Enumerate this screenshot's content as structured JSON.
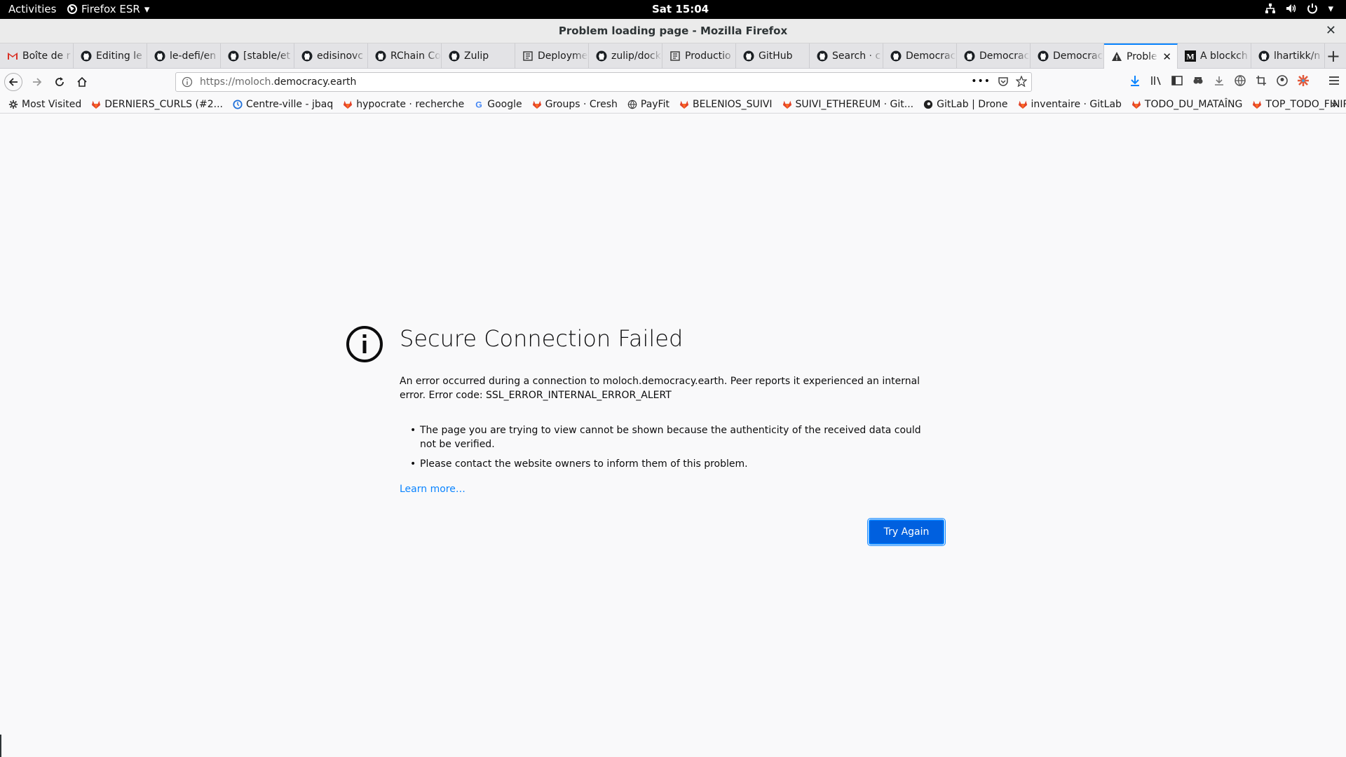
{
  "topbar": {
    "activities": "Activities",
    "app_menu": "Firefox ESR",
    "clock": "Sat 15:04"
  },
  "window": {
    "title": "Problem loading page - Mozilla Firefox"
  },
  "tabs": [
    {
      "label": "Boîte de r",
      "icon": "gmail-icon"
    },
    {
      "label": "Editing le",
      "icon": "github-icon"
    },
    {
      "label": "le-defi/en",
      "icon": "github-icon"
    },
    {
      "label": "[stable/et",
      "icon": "github-icon"
    },
    {
      "label": "edisinovc",
      "icon": "github-icon"
    },
    {
      "label": "RChain Co",
      "icon": "github-icon"
    },
    {
      "label": "Zulip",
      "icon": "github-icon"
    },
    {
      "label": "Deployme",
      "icon": "doc-icon"
    },
    {
      "label": "zulip/dock",
      "icon": "github-icon"
    },
    {
      "label": "Productio",
      "icon": "doc-icon"
    },
    {
      "label": "GitHub",
      "icon": "github-icon"
    },
    {
      "label": "Search · c",
      "icon": "github-icon"
    },
    {
      "label": "Democrac",
      "icon": "github-icon"
    },
    {
      "label": "Democrac",
      "icon": "github-icon"
    },
    {
      "label": "Democrac",
      "icon": "github-icon"
    },
    {
      "label": "Proble",
      "icon": "warning-icon",
      "active": true
    },
    {
      "label": "A blockch",
      "icon": "medium-icon"
    },
    {
      "label": "lhartikk/n",
      "icon": "github-icon"
    }
  ],
  "urlbar": {
    "protocol": "https://moloch.",
    "host": "democracy.earth"
  },
  "bookmarks": [
    {
      "label": "Most Visited",
      "icon": "gear-icon"
    },
    {
      "label": "DERNIERS_CURLS (#2...",
      "icon": "gitlab-icon"
    },
    {
      "label": "Centre-ville - jbaq",
      "icon": "clock-icon"
    },
    {
      "label": "hypocrate · recherche",
      "icon": "gitlab-icon"
    },
    {
      "label": "Google",
      "icon": "google-icon"
    },
    {
      "label": "Groups · Cresh",
      "icon": "gitlab-icon"
    },
    {
      "label": "PayFit",
      "icon": "globe-icon"
    },
    {
      "label": "BELENIOS_SUIVI",
      "icon": "gitlab-icon"
    },
    {
      "label": "SUIVI_ETHEREUM · Git...",
      "icon": "gitlab-icon"
    },
    {
      "label": "GitLab | Drone",
      "icon": "drone-icon"
    },
    {
      "label": "inventaire · GitLab",
      "icon": "gitlab-icon"
    },
    {
      "label": "TODO_DU_MATAÎNG",
      "icon": "gitlab-icon"
    },
    {
      "label": "TOP_TODO_FINIR FLO...",
      "icon": "gitlab-icon"
    }
  ],
  "error": {
    "title": "Secure Connection Failed",
    "description": "An error occurred during a connection to moloch.democracy.earth. Peer reports it experienced an internal error. Error code: SSL_ERROR_INTERNAL_ERROR_ALERT",
    "bullets": [
      "The page you are trying to view cannot be shown because the authenticity of the received data could not be verified.",
      "Please contact the website owners to inform them of this problem."
    ],
    "learn_more": "Learn more…",
    "try_again": "Try Again"
  },
  "colors": {
    "accent": "#0a84ff",
    "button": "#0060df",
    "gitlab": "#e24329"
  }
}
